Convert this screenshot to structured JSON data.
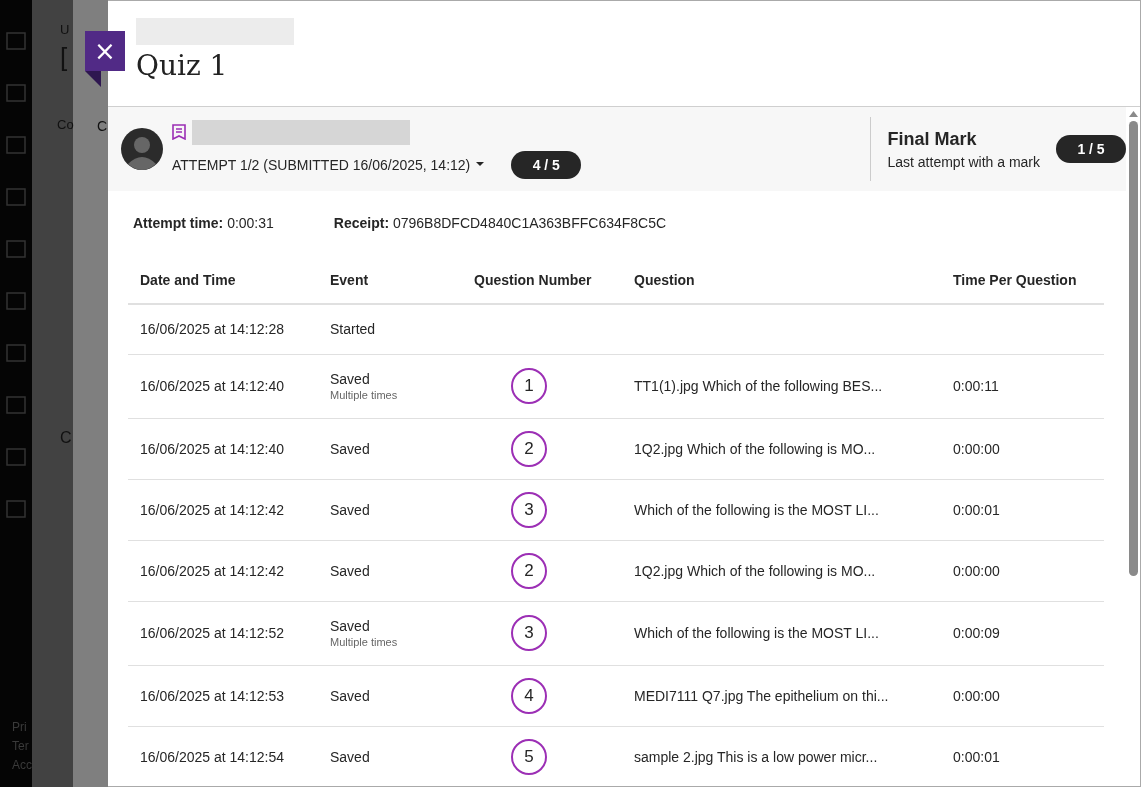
{
  "background_page": {
    "sidebar_footer": [
      "Pri",
      "Ter",
      "Acc"
    ],
    "header_fragments": [
      "U",
      "["
    ],
    "tabs": [
      "Co",
      "C"
    ],
    "section_fragment": "C"
  },
  "panel": {
    "title": "Quiz 1",
    "close_label": "×"
  },
  "attempt": {
    "label": "ATTEMPT 1/2 (SUBMITTED 16/06/2025, 14:12)",
    "score": "4 / 5"
  },
  "final_mark": {
    "title": "Final Mark",
    "subtitle": "Last attempt with a mark",
    "score": "1 / 5"
  },
  "meta": [
    {
      "label": "Attempt time:",
      "value": "0:00:31"
    },
    {
      "label": "Receipt:",
      "value": "0796B8DFCD4840C1A363BFFC634F8C5C"
    }
  ],
  "table": {
    "columns": [
      "Date and Time",
      "Event",
      "Question Number",
      "Question",
      "Time Per Question"
    ],
    "rows": [
      {
        "date": "16/06/2025 at 14:12:28",
        "event": "Started"
      },
      {
        "date": "16/06/2025 at 14:12:40",
        "event": "Saved",
        "note": "Multiple times",
        "number": "1",
        "question": "TT1(1).jpg Which of the following BES...",
        "time": "0:00:11"
      },
      {
        "date": "16/06/2025 at 14:12:40",
        "event": "Saved",
        "number": "2",
        "question": "1Q2.jpg Which of the following is  MO...",
        "time": "0:00:00"
      },
      {
        "date": "16/06/2025 at 14:12:42",
        "event": "Saved",
        "number": "3",
        "question": "Which of the following is the MOST LI...",
        "time": "0:00:01"
      },
      {
        "date": "16/06/2025 at 14:12:42",
        "event": "Saved",
        "number": "2",
        "question": "1Q2.jpg Which of the following is  MO...",
        "time": "0:00:00"
      },
      {
        "date": "16/06/2025 at 14:12:52",
        "event": "Saved",
        "note": "Multiple times",
        "number": "3",
        "question": "Which of the following is the MOST LI...",
        "time": "0:00:09"
      },
      {
        "date": "16/06/2025 at 14:12:53",
        "event": "Saved",
        "number": "4",
        "question": "MEDI7111 Q7.jpg The epithelium on thi...",
        "time": "0:00:00"
      },
      {
        "date": "16/06/2025 at 14:12:54",
        "event": "Saved",
        "number": "5",
        "question": "sample 2.jpg This is a low power micr...",
        "time": "0:00:01"
      }
    ]
  }
}
